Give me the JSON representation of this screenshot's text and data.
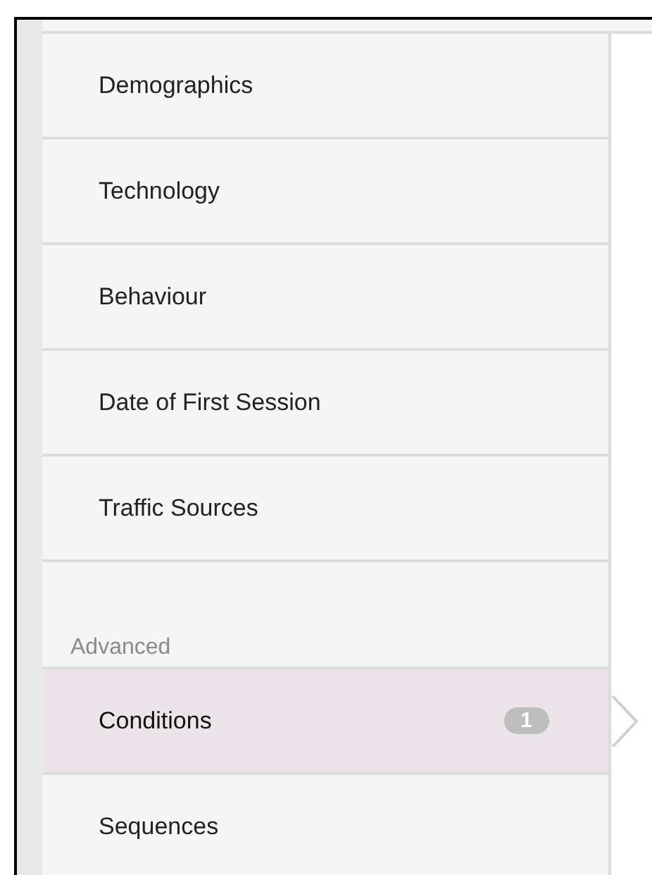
{
  "menu": {
    "items": [
      {
        "label": "Demographics",
        "selected": false
      },
      {
        "label": "Technology",
        "selected": false
      },
      {
        "label": "Behaviour",
        "selected": false
      },
      {
        "label": "Date of First Session",
        "selected": false
      },
      {
        "label": "Traffic Sources",
        "selected": false
      }
    ]
  },
  "advanced": {
    "heading": "Advanced",
    "items": [
      {
        "label": "Conditions",
        "selected": true,
        "badge": "1"
      },
      {
        "label": "Sequences",
        "selected": false
      }
    ]
  }
}
